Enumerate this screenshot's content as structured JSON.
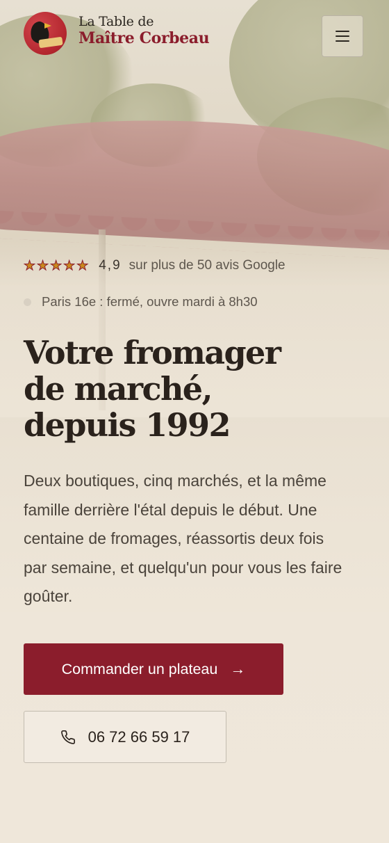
{
  "header": {
    "brand_line1": "La Table de",
    "brand_line2": "Maître Corbeau",
    "logo_icon": "crow-on-cheese-logo",
    "menu_icon": "hamburger-menu-icon"
  },
  "rating": {
    "stars": [
      "★",
      "★",
      "★",
      "★",
      "★"
    ],
    "value": "4,9",
    "text": "sur plus de 50 avis Google"
  },
  "status": {
    "text": "Paris 16e : fermé, ouvre mardi à 8h30"
  },
  "hero": {
    "headline_lines": [
      "Votre fromager",
      "de marché,",
      "depuis 1992"
    ],
    "intro": "Deux boutiques, cinq marchés, et la même famille derrière l'étal depuis le début. Une centaine de fromages, réassortis deux fois par semaine, et quelqu'un pour vous les faire goûter."
  },
  "cta": {
    "order_label": "Commander un plateau",
    "order_arrow": "→",
    "phone_label": "06 72 66 59 17",
    "phone_icon": "phone-icon"
  },
  "colors": {
    "brand": "#8b1d2c",
    "text": "#2a221c",
    "star": "#c98a1e",
    "background": "#efe7da"
  }
}
